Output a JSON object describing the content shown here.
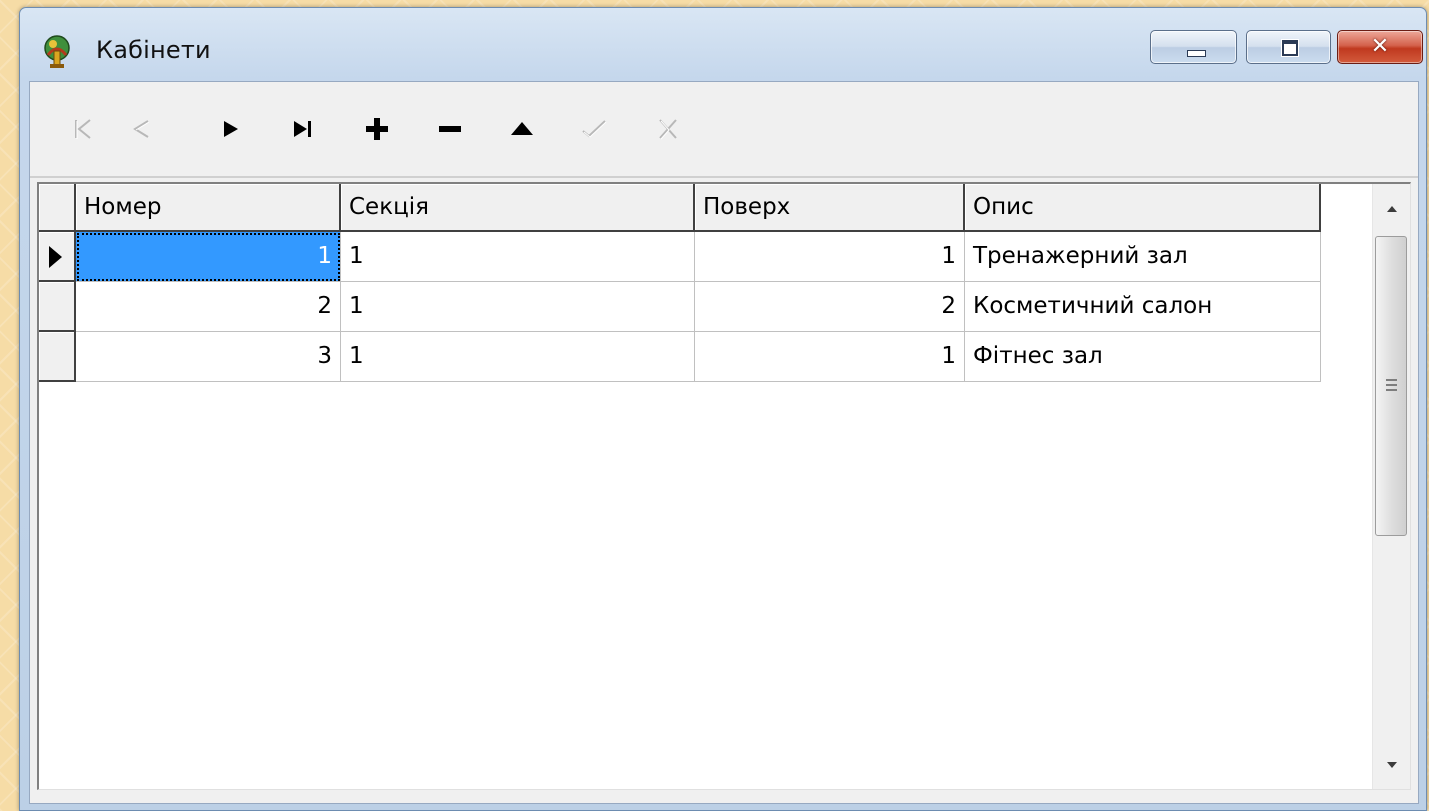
{
  "window": {
    "title": "Кабінети",
    "app_icon": "figure-emblem-icon",
    "controls": {
      "minimize_icon": "minimize-icon",
      "maximize_icon": "maximize-icon",
      "close_label": "✕"
    }
  },
  "navigator": {
    "buttons": [
      {
        "name": "first",
        "icon": "first-record-icon",
        "enabled": false
      },
      {
        "name": "prior",
        "icon": "prior-record-icon",
        "enabled": false
      },
      {
        "name": "next",
        "icon": "next-record-icon",
        "enabled": true
      },
      {
        "name": "last",
        "icon": "last-record-icon",
        "enabled": true
      },
      {
        "name": "insert",
        "icon": "plus-icon",
        "enabled": true
      },
      {
        "name": "delete",
        "icon": "minus-icon",
        "enabled": true
      },
      {
        "name": "edit",
        "icon": "edit-triangle-icon",
        "enabled": true
      },
      {
        "name": "post",
        "icon": "checkmark-icon",
        "enabled": false
      },
      {
        "name": "cancel",
        "icon": "cancel-x-icon",
        "enabled": false
      }
    ]
  },
  "grid": {
    "columns": [
      "Номер",
      "Секція",
      "Поверх",
      "Опис"
    ],
    "rows": [
      [
        "1",
        "1",
        "1",
        "Тренажерний зал"
      ],
      [
        "2",
        "1",
        "2",
        "Косметичний салон"
      ],
      [
        "3",
        "1",
        "1",
        "Фітнес зал"
      ]
    ],
    "current_row": 0
  },
  "colors": {
    "selection": "#3399ff",
    "close_button": "#c0391f",
    "client_bg": "#f0f0f0"
  }
}
